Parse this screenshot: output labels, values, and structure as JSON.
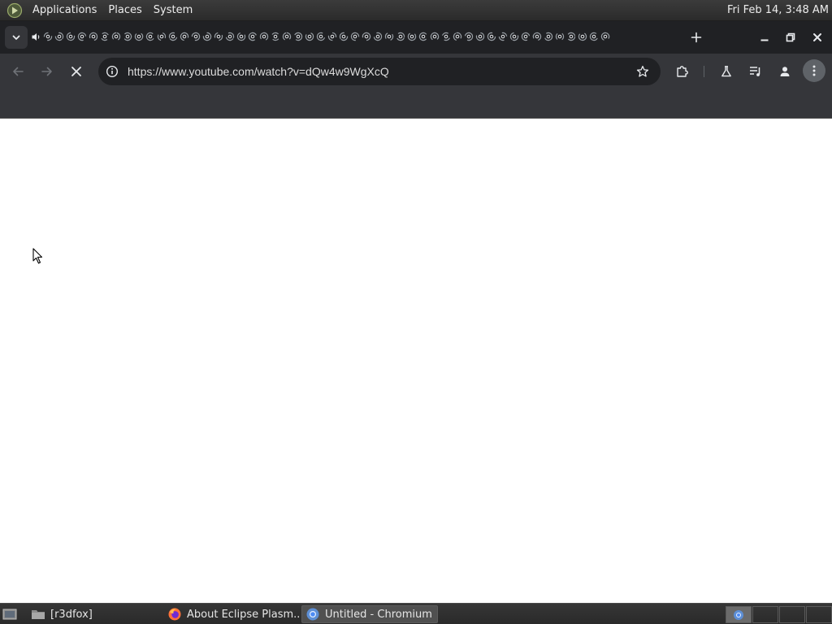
{
  "topbar": {
    "menus": [
      "Applications",
      "Places",
      "System"
    ],
    "clock": "Fri Feb 14,  3:48 AM"
  },
  "tabstrip": {
    "tab_count": 50,
    "icons": {
      "tab_search": "chevron-down-icon",
      "audio": "speaker-icon",
      "new_tab": "plus-icon",
      "minimize": "minimize-icon",
      "maximize": "restore-icon",
      "close": "close-icon"
    }
  },
  "toolbar": {
    "url": "https://www.youtube.com/watch?v=dQw4w9WgXcQ",
    "icons": {
      "back": "arrow-left-icon",
      "forward": "arrow-right-icon",
      "stop": "stop-icon",
      "site_info": "info-icon",
      "bookmark": "star-icon",
      "extensions": "puzzle-icon",
      "labs": "flask-icon",
      "media": "media-control-icon",
      "profile": "person-icon",
      "menu": "more-vertical-icon"
    }
  },
  "taskbar": {
    "tasks": [
      {
        "label": "[r3dfox]",
        "icon": "folder-icon"
      },
      {
        "label": "About Eclipse Plasm...",
        "icon": "firefox-icon"
      },
      {
        "label": "Untitled - Chromium",
        "icon": "chromium-icon"
      }
    ]
  },
  "colors": {
    "panel": "#2b2b2b",
    "chrome_frame": "#202124",
    "toolbar": "#35363a",
    "page": "#ffffff",
    "chromium_blue": "#4c8bf5"
  }
}
